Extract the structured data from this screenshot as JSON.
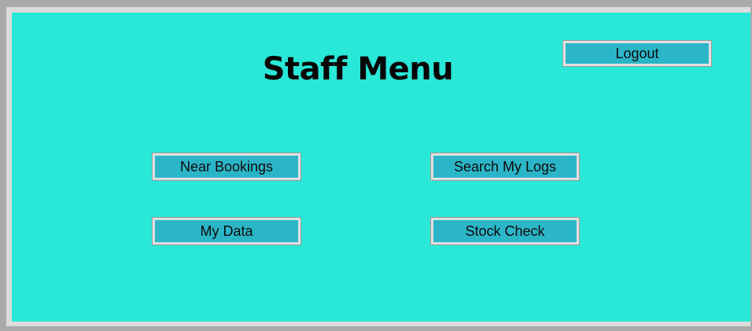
{
  "window": {
    "background_color": "#29e8d8",
    "button_color": "#2bb6c8"
  },
  "header": {
    "title": "Staff Menu"
  },
  "buttons": {
    "logout": "Logout",
    "near_bookings": "Near Bookings",
    "search_my_logs": "Search My Logs",
    "my_data": "My Data",
    "stock_check": "Stock Check"
  }
}
